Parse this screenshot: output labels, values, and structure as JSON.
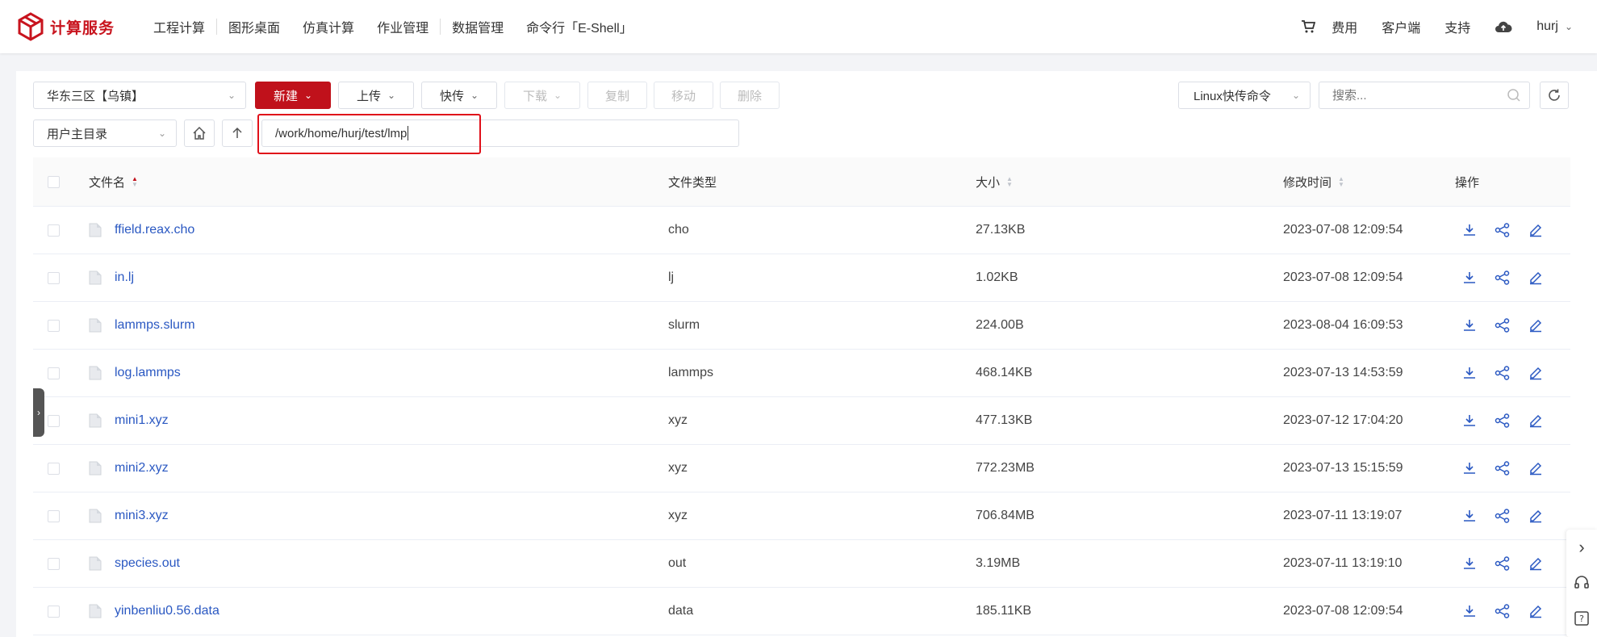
{
  "brand": {
    "name": "计算服务",
    "color": "#c8141e"
  },
  "nav": [
    "工程计算",
    "图形桌面",
    "仿真计算",
    "作业管理",
    "数据管理",
    "命令行「E-Shell」"
  ],
  "top_right": {
    "billing": "费用",
    "client": "客户端",
    "support": "支持",
    "user": "hurj"
  },
  "toolbar": {
    "region": "华东三区【乌镇】",
    "new": "新建",
    "upload": "上传",
    "fast_upload": "快传",
    "download": "下载",
    "copy": "复制",
    "move": "移动",
    "delete": "删除",
    "linux_cmd": "Linux快传命令",
    "search_placeholder": "搜索..."
  },
  "pathbar": {
    "root_select": "用户主目录",
    "path": "/work/home/hurj/test/lmp"
  },
  "table": {
    "headers": {
      "name": "文件名",
      "type": "文件类型",
      "size": "大小",
      "mtime": "修改时间",
      "ops": "操作"
    },
    "rows": [
      {
        "name": "ffield.reax.cho",
        "type": "cho",
        "size": "27.13KB",
        "mtime": "2023-07-08 12:09:54"
      },
      {
        "name": "in.lj",
        "type": "lj",
        "size": "1.02KB",
        "mtime": "2023-07-08 12:09:54"
      },
      {
        "name": "lammps.slurm",
        "type": "slurm",
        "size": "224.00B",
        "mtime": "2023-08-04 16:09:53"
      },
      {
        "name": "log.lammps",
        "type": "lammps",
        "size": "468.14KB",
        "mtime": "2023-07-13 14:53:59"
      },
      {
        "name": "mini1.xyz",
        "type": "xyz",
        "size": "477.13KB",
        "mtime": "2023-07-12 17:04:20"
      },
      {
        "name": "mini2.xyz",
        "type": "xyz",
        "size": "772.23MB",
        "mtime": "2023-07-13 15:15:59"
      },
      {
        "name": "mini3.xyz",
        "type": "xyz",
        "size": "706.84MB",
        "mtime": "2023-07-11 13:19:07"
      },
      {
        "name": "species.out",
        "type": "out",
        "size": "3.19MB",
        "mtime": "2023-07-11 13:19:10"
      },
      {
        "name": "yinbenliu0.56.data",
        "type": "data",
        "size": "185.11KB",
        "mtime": "2023-07-08 12:09:54"
      }
    ]
  },
  "colors": {
    "accent": "#c0111b",
    "link": "#2a58c2",
    "highlight_box": "#e0101a"
  }
}
